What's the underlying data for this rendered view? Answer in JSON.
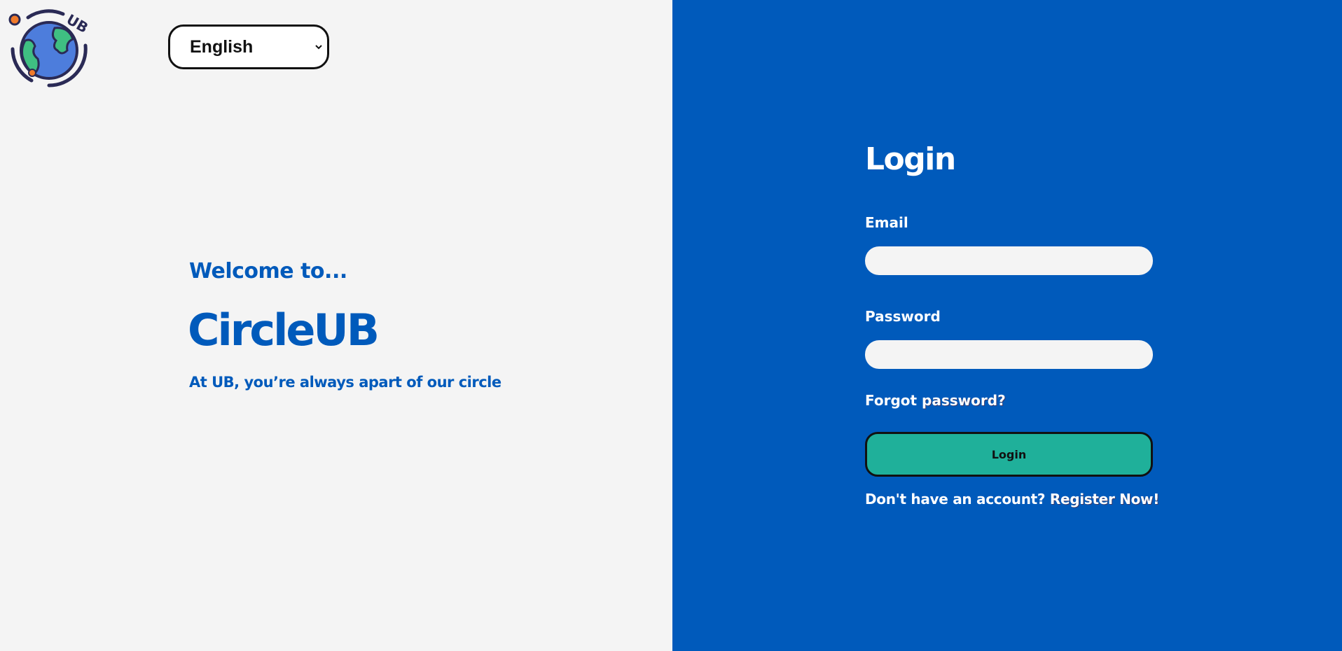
{
  "logo": {
    "text": "UB",
    "icon": "globe-logo-icon"
  },
  "language": {
    "selected": "English",
    "options": [
      "English"
    ]
  },
  "hero": {
    "welcome": "Welcome to...",
    "brand": "CircleUB",
    "tagline": "At UB, you’re always apart of our circle"
  },
  "login": {
    "title": "Login",
    "email_label": "Email",
    "email_value": "",
    "password_label": "Password",
    "password_value": "",
    "forgot_prefix": "Forgot ",
    "forgot_link": "password?",
    "submit_label": "Login",
    "register_prefix": "Don't have an account? ",
    "register_link": "Register Now!"
  },
  "colors": {
    "primary_blue": "#005abb",
    "background_light": "#f4f4f4",
    "button_teal": "#1fb09a",
    "text_white": "#ffffff"
  }
}
